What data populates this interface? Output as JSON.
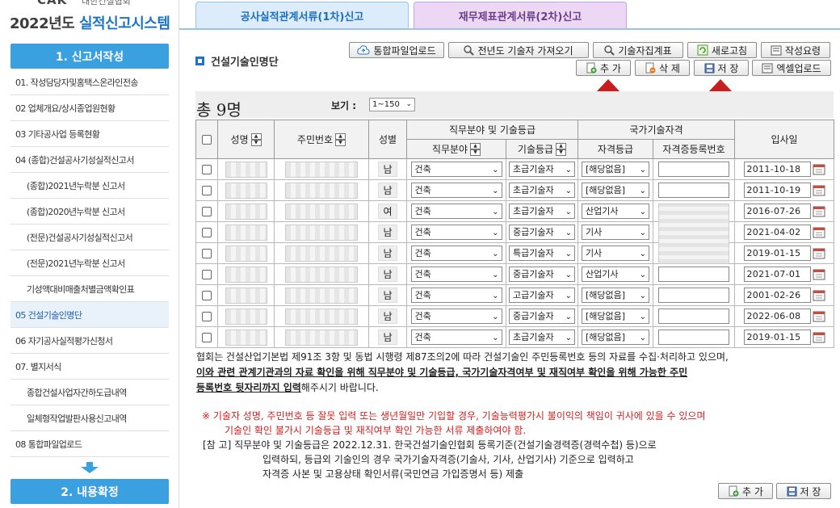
{
  "sidebar": {
    "logo_text": "CAK",
    "assoc_text": "대한건설협회",
    "system_year": "2022년도",
    "system_name": "실적신고시스템",
    "step1_label": "1. 신고서작성",
    "step2_label": "2. 내용확정",
    "menu": [
      {
        "label": "01. 작성담당자및홈택스온라인전송"
      },
      {
        "label": "02 업체개요/상시종업원현황"
      },
      {
        "label": "03 기타공사업 등록현황"
      },
      {
        "label": "04 (종합)건설공사기성실적신고서"
      },
      {
        "label": "(종합)2021년누락분 신고서"
      },
      {
        "label": "(종합)2020년누락분 신고서"
      },
      {
        "label": "(전문)건설공사기성실적신고서"
      },
      {
        "label": "(전문)2021년누락분 신고서"
      },
      {
        "label": "기성액대비매출처별금액확인표"
      },
      {
        "label": "05 건설기술인명단"
      },
      {
        "label": "06 자기공사실적평가신청서"
      },
      {
        "label": "07. 별지서식"
      },
      {
        "label": "종합건설사업자간하도급내역"
      },
      {
        "label": "일체형작업발판사용신고내역"
      },
      {
        "label": "08 통합파일업로드"
      }
    ]
  },
  "tabs": {
    "tab1": "공사실적관계서류(1차)신고",
    "tab2": "재무제표관계서류(2차)신고"
  },
  "section_title": "건설기술인명단",
  "toolbar": {
    "upload": "통합파일업로드",
    "prev_year": "전년도 기술자 가져오기",
    "collect": "기술자집계표",
    "refresh": "새로고침",
    "guide": "작성요령",
    "add": "추 가",
    "delete": "삭 제",
    "save": "저 장",
    "excel": "엑셀업로드"
  },
  "count_text": "총 9명",
  "view_label": "보기 :",
  "view_value": "1~150",
  "table": {
    "headers": {
      "name": "성명",
      "resident_no": "주민번호",
      "gender": "성별",
      "job_group": "직무분야 및 기술등급",
      "job_field": "직무분야",
      "tech_grade": "기술등급",
      "national_group": "국가기술자격",
      "license_grade": "자격등급",
      "license_no": "자격증등록번호",
      "join_date": "입사일"
    },
    "rows": [
      {
        "gender": "남",
        "field": "건축",
        "grade": "초급기술자",
        "license": "[해당없음]",
        "date": "2011-10-18"
      },
      {
        "gender": "남",
        "field": "건축",
        "grade": "초급기술자",
        "license": "[해당없음]",
        "date": "2011-10-19"
      },
      {
        "gender": "여",
        "field": "건축",
        "grade": "초급기술자",
        "license": "산업기사",
        "date": "2016-07-26"
      },
      {
        "gender": "남",
        "field": "건축",
        "grade": "중급기술자",
        "license": "기사",
        "date": "2021-04-02"
      },
      {
        "gender": "남",
        "field": "건축",
        "grade": "특급기술자",
        "license": "기사",
        "date": "2019-01-15"
      },
      {
        "gender": "남",
        "field": "건축",
        "grade": "중급기술자",
        "license": "산업기사",
        "date": "2021-07-01"
      },
      {
        "gender": "남",
        "field": "건축",
        "grade": "고급기술자",
        "license": "[해당없음]",
        "date": "2001-02-26"
      },
      {
        "gender": "남",
        "field": "건축",
        "grade": "중급기술자",
        "license": "[해당없음]",
        "date": "2022-06-08"
      },
      {
        "gender": "남",
        "field": "건축",
        "grade": "초급기술자",
        "license": "[해당없음]",
        "date": "2019-01-15"
      }
    ]
  },
  "notices": {
    "line1": "협회는 건설산업기본법 제91조 3항 및 동법 시행령 제87조의2에 따라 건설기술인 주민등록번호 등의 자료를 수집·처리하고 있으며,",
    "line2": "이와 관련 관계기관과의 자료 확인을 위해 직무분야 및 기술등급, 국가기술자격여부 및 재직여부 확인을 위해 가능한 주민",
    "line3_bold": "등록번호 뒷자리까지 입력",
    "line3_rest": "해주시기 바랍니다.",
    "warn1": "※ 기술자 성명, 주민번호 등 잘못 입력 또는 생년월일만 기입할 경우, 기술능력평가시 불이익의 책임이 귀사에 있을 수 있으며",
    "warn2": "기술인 확인 불가시 기술등급 및 재직여부 확인 가능한 서류 제출하여야 함.",
    "ref1": "[참 고] 직무분야 및 기술등급은 2022.12.31. 한국건설기술인협회 등록기준(건설기술경력증(경력수첩) 등)으로",
    "ref2": "입력하되, 등급외 기술인의 경우 국가기술자격증(기술사, 기사, 산업기사) 기준으로 입력하고",
    "ref3": "자격증 사본 및 고용상태 확인서류(국민연금 가입증명서 등) 제출"
  },
  "bottom_buttons": {
    "add": "추 가",
    "save": "저 장"
  },
  "colors": {
    "accent_blue": "#3aa0e0",
    "tab1_bg": "#dcecfa",
    "tab2_bg": "#ecd7f4",
    "warn_red": "#d21f1f",
    "arrow_red": "#c81e1e"
  }
}
